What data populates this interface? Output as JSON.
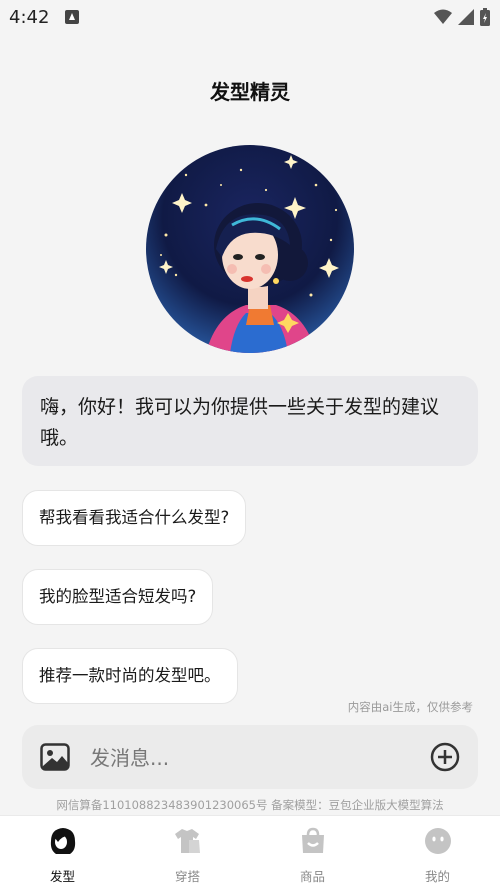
{
  "status_bar": {
    "time": "4:42"
  },
  "header": {
    "title": "发型精灵"
  },
  "chat": {
    "greeting": "嗨，你好！我可以为你提供一些关于发型的建议哦。",
    "suggestions": [
      "帮我看看我适合什么发型?",
      "我的脸型适合短发吗?",
      "推荐一款时尚的发型吧。"
    ],
    "ai_note": "内容由ai生成，仅供参考"
  },
  "input": {
    "placeholder": "发消息..."
  },
  "footer": {
    "legal": "网信算备110108823483901230065号 备案模型：豆包企业版大模型算法"
  },
  "tabs": [
    {
      "label": "发型",
      "icon": "hair-icon",
      "active": true
    },
    {
      "label": "穿搭",
      "icon": "clothes-icon",
      "active": false
    },
    {
      "label": "商品",
      "icon": "shopping-bag-icon",
      "active": false
    },
    {
      "label": "我的",
      "icon": "profile-icon",
      "active": false
    }
  ],
  "colors": {
    "background": "#f4f4f4",
    "bubble": "#e9e9ec",
    "active_tab": "#111111",
    "inactive_tab": "#c4c4c4"
  }
}
